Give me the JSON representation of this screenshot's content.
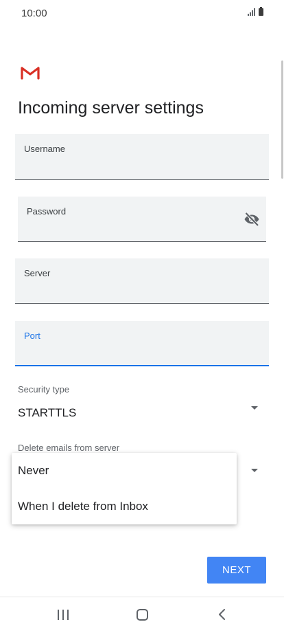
{
  "status_bar": {
    "time": "10:00"
  },
  "header": {
    "title": "Incoming server settings"
  },
  "form": {
    "username": {
      "label": "Username",
      "value": ""
    },
    "password": {
      "label": "Password",
      "value": ""
    },
    "server": {
      "label": "Server",
      "value": ""
    },
    "port": {
      "label": "Port",
      "value": ""
    },
    "security_type": {
      "label": "Security type",
      "value": "STARTTLS"
    },
    "delete_emails": {
      "label": "Delete emails from server"
    }
  },
  "delete_menu": {
    "options": [
      "Never",
      "When I delete from Inbox"
    ]
  },
  "actions": {
    "next_label": "NEXT"
  },
  "colors": {
    "accent": "#4285f4",
    "focus": "#1a73e8",
    "gmail_red": "#d93025",
    "field_bg": "#f1f3f4"
  },
  "icons": {
    "logo": "gmail-logo",
    "password_toggle": "eye-off-icon",
    "dropdown": "dropdown-arrow-icon",
    "nav": [
      "recent-apps-icon",
      "home-icon",
      "back-icon"
    ]
  }
}
